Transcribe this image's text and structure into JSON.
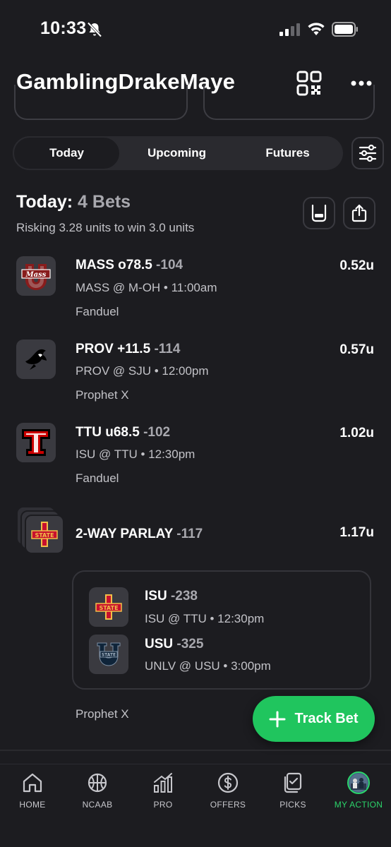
{
  "status_bar": {
    "time": "10:33"
  },
  "header": {
    "username": "GamblingDrakeMaye"
  },
  "tabs": [
    {
      "label": "Today",
      "active": true
    },
    {
      "label": "Upcoming",
      "active": false
    },
    {
      "label": "Futures",
      "active": false
    }
  ],
  "summary": {
    "title_label": "Today:",
    "title_count": "4 Bets",
    "subtitle": "Risking 3.28 units to win 3.0 units"
  },
  "bets": [
    {
      "pick": "MASS o78.5",
      "odds": "-104",
      "matchup": "MASS @ M-OH • 11:00am",
      "book": "Fanduel",
      "units": "0.52u",
      "logo": "umass-logo-icon"
    },
    {
      "pick": "PROV +11.5",
      "odds": "-114",
      "matchup": "PROV @ SJU • 12:00pm",
      "book": "Prophet X",
      "units": "0.57u",
      "logo": "providence-logo-icon"
    },
    {
      "pick": "TTU u68.5",
      "odds": "-102",
      "matchup": "ISU @ TTU • 12:30pm",
      "book": "Fanduel",
      "units": "1.02u",
      "logo": "texas-tech-logo-icon"
    }
  ],
  "parlay": {
    "pick": "2-WAY PARLAY",
    "odds": "-117",
    "units": "1.17u",
    "book": "Prophet X",
    "legs": [
      {
        "pick": "ISU",
        "odds": "-238",
        "matchup": "ISU @ TTU • 12:30pm",
        "logo": "iowa-state-logo-icon"
      },
      {
        "pick": "USU",
        "odds": "-325",
        "matchup": "UNLV @ USU • 3:00pm",
        "logo": "utah-state-logo-icon"
      }
    ]
  },
  "track_button": {
    "label": "Track Bet"
  },
  "bottom_nav": [
    {
      "label": "HOME",
      "icon": "home-icon"
    },
    {
      "label": "NCAAB",
      "icon": "basketball-icon"
    },
    {
      "label": "PRO",
      "icon": "chart-icon"
    },
    {
      "label": "OFFERS",
      "icon": "dollar-icon"
    },
    {
      "label": "PICKS",
      "icon": "picks-icon"
    },
    {
      "label": "MY ACTION",
      "icon": "avatar-icon",
      "active": true
    }
  ],
  "colors": {
    "accent": "#20c55e",
    "background": "#1c1c20",
    "active_nav": "#2bd46a"
  }
}
